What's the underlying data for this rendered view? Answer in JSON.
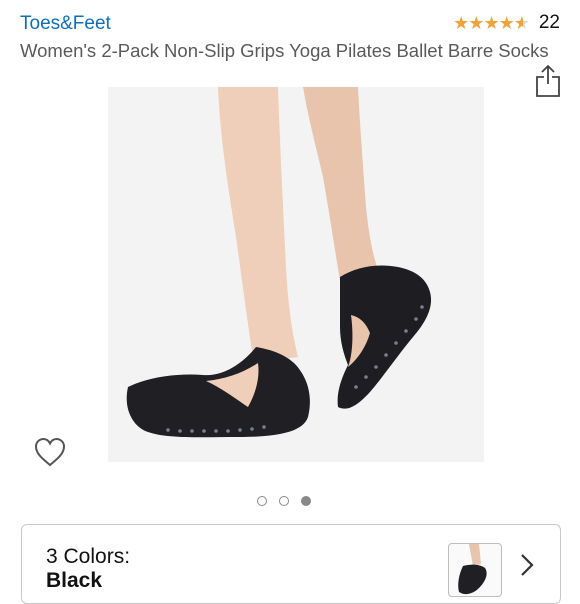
{
  "product": {
    "brand": "Toes&Feet",
    "rating": 4.5,
    "review_count": "22",
    "title": "Women's 2-Pack Non-Slip Grips Yoga Pilates Ballet Barre Socks"
  },
  "gallery": {
    "image_count": 3,
    "active_index": 2
  },
  "icons": {
    "share": "share-icon",
    "wishlist": "heart-outline-icon",
    "next": "chevron-right-icon"
  },
  "variants": {
    "color_count_label": "3 Colors:",
    "selected_color": "Black"
  },
  "colors": {
    "brand_link": "#0d6fb8",
    "star": "#f0a33a",
    "title_text": "#5a5a5a"
  }
}
